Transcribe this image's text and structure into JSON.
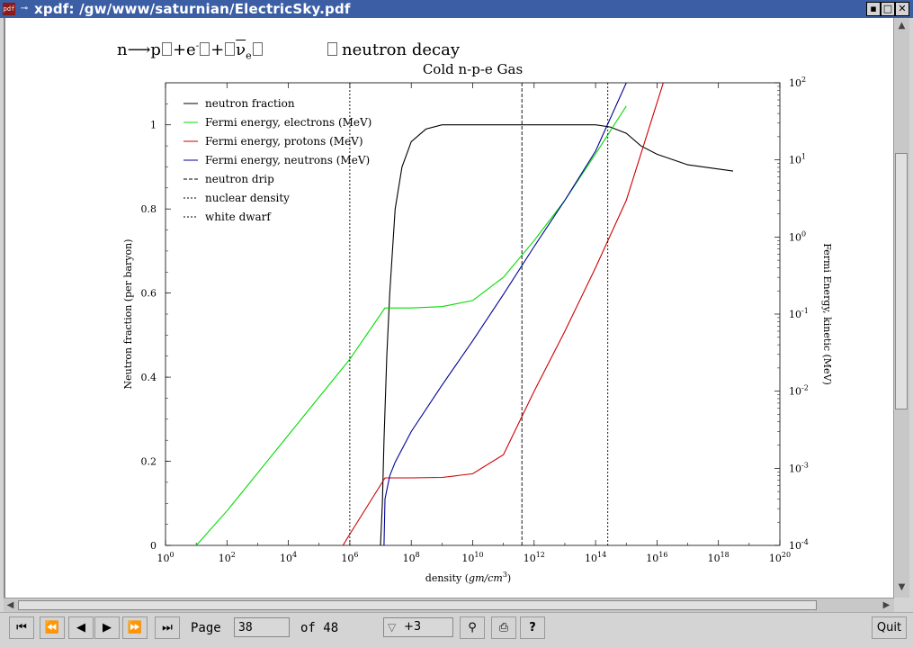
{
  "window": {
    "app_icon": "pdf",
    "title": "xpdf: /gw/www/saturnian/ElectricSky.pdf"
  },
  "toolbar": {
    "page_label": "Page",
    "page_value": "38",
    "of_label": "of 48",
    "zoom_value": "+3",
    "quit_label": "Quit",
    "icons": [
      "first-page-icon",
      "back-10-icon",
      "prev-page-icon",
      "next-page-icon",
      "forward-10-icon",
      "forward-history-icon",
      "find-icon",
      "print-icon",
      "help-icon"
    ]
  },
  "page": {
    "equation": {
      "n": "n",
      "p": "p",
      "e": "e",
      "e_sup": "-",
      "nu": "ν",
      "nu_sub": "e"
    },
    "equation_label": "neutron decay"
  },
  "chart_data": {
    "type": "line",
    "title": "Cold n-p-e Gas",
    "xlabel": "density",
    "xlabel_units": "gm/cm",
    "xlabel_units_sup": "3",
    "ylabel_left": "Neutron fraction (per baryon)",
    "ylabel_right": "Fermi Energy, kinetic (MeV)",
    "x_scale": "log",
    "x_range": [
      1,
      1e+20
    ],
    "x_ticks": [
      "10^0",
      "10^2",
      "10^4",
      "10^6",
      "10^8",
      "10^10",
      "10^12",
      "10^14",
      "10^16",
      "10^18",
      "10^20"
    ],
    "y_left_range": [
      0,
      1.1
    ],
    "y_left_ticks": [
      "0",
      "0.2",
      "0.4",
      "0.6",
      "0.8",
      "1"
    ],
    "y_right_scale": "log",
    "y_right_range": [
      0.0001,
      100
    ],
    "y_right_ticks": [
      "10^-4",
      "10^-3",
      "10^-2",
      "10^-1",
      "10^0",
      "10^1",
      "10^2"
    ],
    "legend_position": "top-left",
    "grid": false,
    "series": [
      {
        "name": "neutron fraction",
        "axis": "left",
        "color": "#000000",
        "style": "solid",
        "x": [
          10000000.0,
          11500000.0,
          13000000.0,
          16000000.0,
          20000000.0,
          30000000.0,
          50000000.0,
          100000000.0,
          300000000.0,
          1000000000.0,
          10000000000.0,
          1000000000000.0,
          100000000000000.0,
          300000000000000.0,
          1000000000000000.0,
          3000000000000000.0,
          1e+16,
          1e+17,
          1e+18,
          3e+18
        ],
        "y": [
          0,
          0.1,
          0.25,
          0.45,
          0.6,
          0.8,
          0.9,
          0.96,
          0.99,
          1.0,
          1.0,
          1.0,
          1.0,
          0.995,
          0.98,
          0.95,
          0.93,
          0.905,
          0.895,
          0.89
        ]
      },
      {
        "name": "Fermi energy, electrons (MeV)",
        "axis": "right",
        "color": "#00dd00",
        "style": "solid",
        "x": [
          10.0,
          100.0,
          10000.0,
          1000000.0,
          14000000.0,
          100000000.0,
          1000000000.0,
          10000000000.0,
          100000000000.0,
          1000000000000.0,
          10000000000000.0,
          100000000000000.0,
          1000000000000000.0
        ],
        "y": [
          0.0001,
          0.00028,
          0.0027,
          0.026,
          0.12,
          0.12,
          0.125,
          0.15,
          0.3,
          0.9,
          3,
          12,
          50
        ]
      },
      {
        "name": "Fermi energy, protons (MeV)",
        "axis": "right",
        "color": "#cc0000",
        "style": "solid",
        "x": [
          600000.0,
          1000000.0,
          14000000.0,
          100000000.0,
          1000000000.0,
          10000000000.0,
          100000000000.0,
          1000000000000.0,
          10000000000000.0,
          100000000000000.0,
          1000000000000000.0,
          1.6e+16
        ],
        "y": [
          0.0001,
          0.00014,
          0.00075,
          0.00075,
          0.00076,
          0.00085,
          0.0015,
          0.01,
          0.06,
          0.4,
          3,
          100
        ]
      },
      {
        "name": "Fermi energy, neutrons (MeV)",
        "axis": "right",
        "color": "#000099",
        "style": "solid",
        "x": [
          13000000.0,
          14000000.0,
          20000000.0,
          30000000.0,
          100000000.0,
          1000000000.0,
          10000000000.0,
          100000000000.0,
          1000000000000.0,
          10000000000000.0,
          100000000000000.0,
          1000000000000000.0
        ],
        "y": [
          0.0001,
          0.0004,
          0.0008,
          0.0012,
          0.003,
          0.012,
          0.045,
          0.18,
          0.75,
          3,
          13,
          100
        ]
      },
      {
        "name": "neutron drip",
        "style": "dashed",
        "color": "#000000",
        "x_value": 400000000000.0
      },
      {
        "name": "nuclear density",
        "style": "dotted",
        "color": "#000000",
        "x_value": 250000000000000.0
      },
      {
        "name": "white dwarf",
        "style": "dotted",
        "color": "#000000",
        "x_value": 1000000.0
      }
    ]
  }
}
